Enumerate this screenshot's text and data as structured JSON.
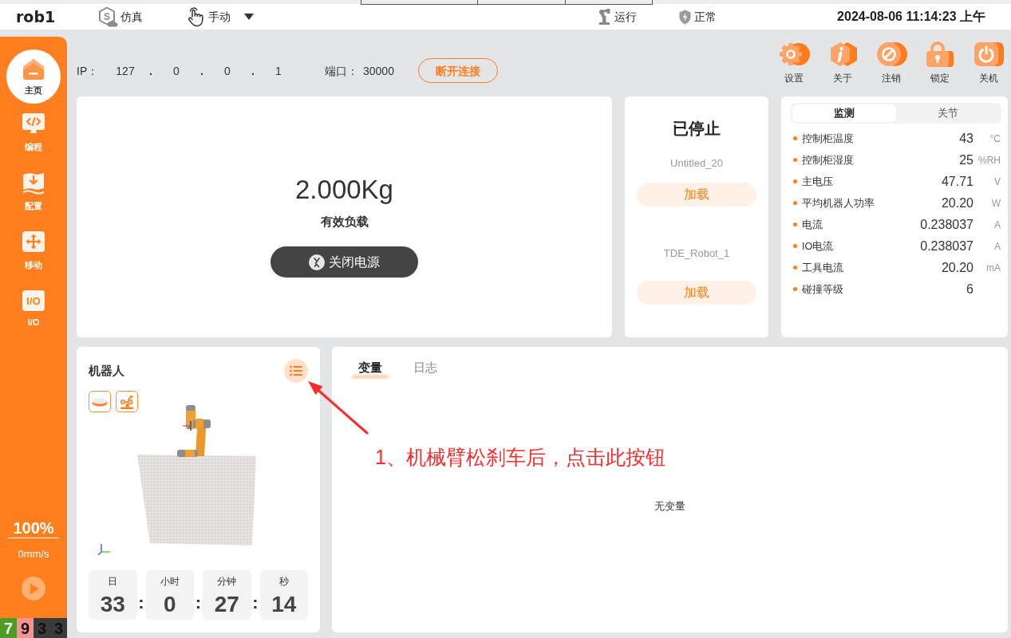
{
  "header": {
    "title": "rob1",
    "mode": {
      "badge": "S",
      "label": "仿真"
    },
    "control": {
      "label": "手动"
    },
    "run_status": "运行",
    "safety_status": "正常",
    "datetime": "2024-08-06 11:14:23 上午"
  },
  "sidebar": {
    "items": [
      {
        "label": "主页",
        "selected": true
      },
      {
        "label": "编程",
        "selected": false
      },
      {
        "label": "配置",
        "selected": false
      },
      {
        "label": "移动",
        "selected": false
      },
      {
        "label": "I/O",
        "badge": "I/O",
        "selected": false
      }
    ],
    "speed": "100%",
    "velocity": "0mm/s",
    "counters": [
      {
        "text": "7",
        "color": "#4f9b25"
      },
      {
        "text": "9",
        "color": "#f79393"
      },
      {
        "text": "3",
        "color": "#3a3a3a"
      },
      {
        "text": "3",
        "color": "#3a3a3a"
      }
    ]
  },
  "connection": {
    "ip_label": "IP：",
    "ip_parts": [
      "127",
      "0",
      "0",
      "1"
    ],
    "ip_separators": [
      ".",
      ".",
      "."
    ],
    "port_label": "端口：",
    "port": "30000",
    "button": "断开连接"
  },
  "actions": [
    {
      "label": "设置"
    },
    {
      "label": "关于"
    },
    {
      "label": "注销"
    },
    {
      "label": "锁定"
    },
    {
      "label": "关机"
    }
  ],
  "payload": {
    "value": "2.000Kg",
    "label": "有效负载",
    "power_button": "关闭电源"
  },
  "program": {
    "status": "已停止",
    "programs": [
      {
        "name": "Untitled_20",
        "button": "加载"
      },
      {
        "name": "TDE_Robot_1",
        "button": "加载"
      }
    ]
  },
  "monitor": {
    "tabs": [
      {
        "label": "监测",
        "selected": true
      },
      {
        "label": "关节",
        "selected": false
      }
    ],
    "rows": [
      {
        "label": "控制柜温度",
        "value": "43",
        "unit": "°C"
      },
      {
        "label": "控制柜湿度",
        "value": "25",
        "unit": "%RH"
      },
      {
        "label": "主电压",
        "value": "47.71",
        "unit": "V"
      },
      {
        "label": "平均机器人功率",
        "value": "20.20",
        "unit": "W"
      },
      {
        "label": "电流",
        "value": "0.238037",
        "unit": "A"
      },
      {
        "label": "IO电流",
        "value": "0.238037",
        "unit": "A"
      },
      {
        "label": "工具电流",
        "value": "20.20",
        "unit": "mA"
      },
      {
        "label": "碰撞等级",
        "value": "6"
      }
    ]
  },
  "robot": {
    "title": "机器人",
    "runtime": [
      {
        "unit": "日",
        "value": "33"
      },
      {
        "unit": "小时",
        "value": "0"
      },
      {
        "unit": "分钟",
        "value": "27"
      },
      {
        "unit": "秒",
        "value": "14"
      }
    ],
    "separators": [
      ":",
      ":",
      ":"
    ]
  },
  "variables": {
    "tabs": [
      {
        "label": "变量",
        "selected": true
      },
      {
        "label": "日志",
        "selected": false
      }
    ],
    "empty_text": "无变量"
  },
  "annotation": {
    "text": "1、机械臂松刹车后，点击此按钮"
  }
}
